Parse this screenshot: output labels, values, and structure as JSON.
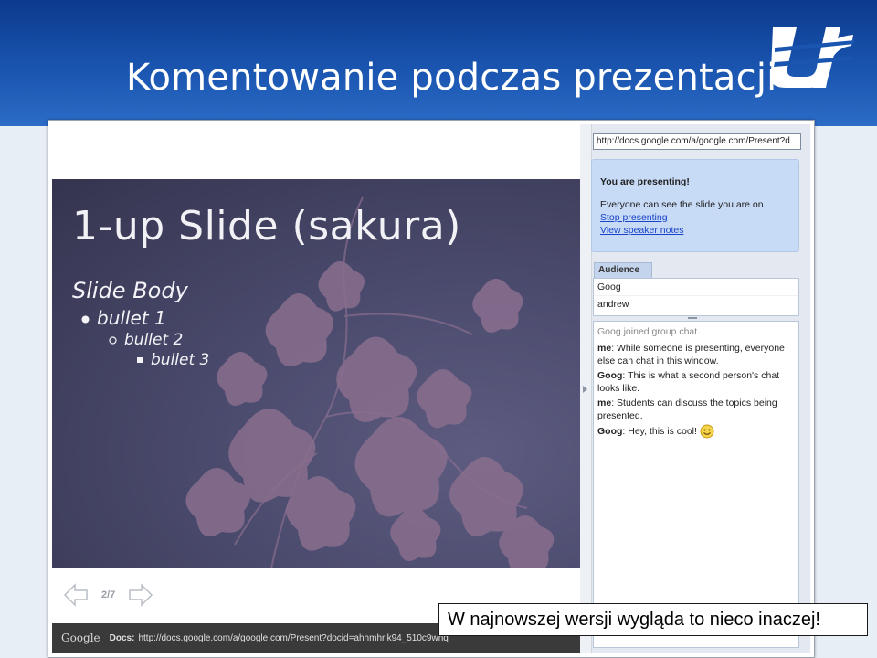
{
  "header": {
    "title": "Komentowanie podczas prezentacji"
  },
  "slide": {
    "title": "1-up Slide (sakura)",
    "body_title": "Slide Body",
    "bullet1": "bullet 1",
    "bullet2": "bullet 2",
    "bullet3": "bullet 3"
  },
  "nav": {
    "page": "2/7"
  },
  "statusbar": {
    "google": "Google",
    "docs_label": "Docs:",
    "url": "http://docs.google.com/a/google.com/Present?docid=ahhmhrjk94_510c9whq"
  },
  "sidebar": {
    "url": "http://docs.google.com/a/google.com/Present?d",
    "presenting_title": "You are presenting!",
    "presenting_desc": "Everyone can see the slide you are on.",
    "stop_link": "Stop presenting",
    "notes_link": "View speaker notes",
    "audience_tab": "Audience",
    "audience": [
      "Goog",
      "andrew"
    ]
  },
  "chat": {
    "system": "Goog joined group chat.",
    "messages": [
      {
        "who": "me",
        "text": ": While someone is presenting, everyone else can chat in this window."
      },
      {
        "who": "Goog",
        "text": ": This is what a second person's chat looks like."
      },
      {
        "who": "me",
        "text": ": Students can discuss the topics being presented."
      },
      {
        "who": "Goog",
        "text": ": Hey, this is cool! "
      }
    ]
  },
  "caption": "W najnowszej wersji wygląda to nieco inaczej!",
  "colors": {
    "header": "#1a55b0",
    "slide_bg": "#4a4a6d",
    "flower": "#8a6e8e",
    "link": "#1a44c8",
    "panel": "#c7daf6"
  },
  "icons": [
    "logo",
    "prev-arrow-icon",
    "next-arrow-icon",
    "smiley-icon",
    "collapse-arrow-icon"
  ]
}
